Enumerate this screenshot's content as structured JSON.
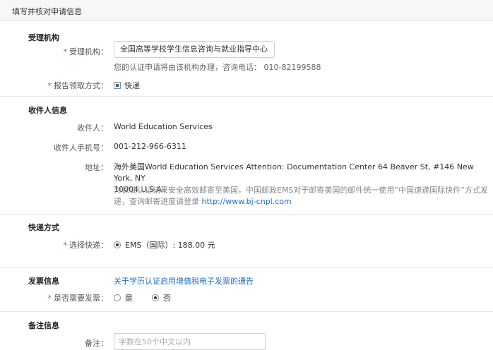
{
  "header": {
    "title": "填写并核对申请信息"
  },
  "agency": {
    "section_title": "受理机构",
    "field_label": "受理机构：",
    "field_value": "全国高等学校学生信息咨询与就业指导中心",
    "hint": "您的认证申请将由该机构办理，咨询电话： 010-82199588",
    "report_label": "报告领取方式：",
    "report_option": "快递",
    "report_checked": true
  },
  "recipient": {
    "section_title": "收件人信息",
    "name_label": "收件人：",
    "name_value": "World Education Services",
    "phone_label": "收件人手机号：",
    "phone_value": "001-212-966-6311",
    "address_label": "地址：",
    "address_line1": "海外美国World Education Services Attention: Documentation Center 64 Beaver St, #146 New York, NY",
    "address_line2": "10004 U.S.A.",
    "note_line1": "为保证认证结果安全高效邮寄至美国，中国邮政EMS对于邮寄美国的邮件统一使用“中国速递国际快件”方式发",
    "note_line2_prefix": "递，查询邮寄进度请登录 ",
    "note_link": "http://www.bj-cnpl.com"
  },
  "shipping": {
    "section_title": "快递方式",
    "select_label": "选择快递：",
    "option_label": "EMS（国际）: 188.00 元",
    "option_checked": true
  },
  "invoice": {
    "section_title": "发票信息",
    "notice_link": "关于学历认证启用增值税电子发票的通告",
    "need_label": "是否需要发票：",
    "option_yes": "是",
    "option_no": "否",
    "selected": "否"
  },
  "remarks": {
    "section_title": "备注信息",
    "label": "备注：",
    "placeholder": "字数在50个中文以内"
  },
  "colors": {
    "required": "#e4393c",
    "link": "#1f6fbd",
    "header_bg": "#f7f7f7"
  }
}
